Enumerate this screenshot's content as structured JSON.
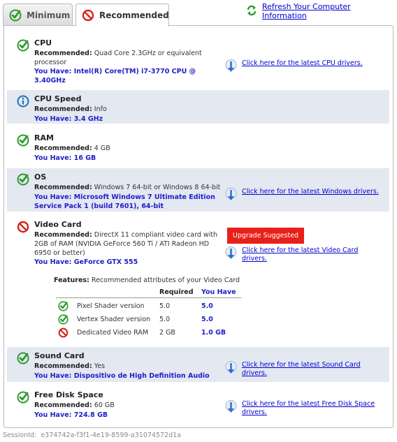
{
  "tabs": {
    "minimum_label": "Minimum",
    "recommended_label": "Recommended"
  },
  "refresh_label": "Refresh Your Computer Information",
  "sections": {
    "cpu": {
      "title": "CPU",
      "recommended_label": "Recommended:",
      "recommended_value": "Quad Core 2.3GHz or equivalent processor",
      "have_label": "You Have:",
      "have_value": "Intel(R) Core(TM) i7-3770 CPU @ 3.40GHz",
      "driver_link": "Click here for the latest CPU drivers.",
      "status_icon": "check-icon"
    },
    "cpu_speed": {
      "title": "CPU Speed",
      "recommended_label": "Recommended:",
      "recommended_value": "Info",
      "have_label": "You Have:",
      "have_value": "3.4 GHz",
      "status_icon": "info-icon"
    },
    "ram": {
      "title": "RAM",
      "recommended_label": "Recommended:",
      "recommended_value": "4 GB",
      "have_label": "You Have:",
      "have_value": "16 GB",
      "status_icon": "check-icon"
    },
    "os": {
      "title": "OS",
      "recommended_label": "Recommended:",
      "recommended_value": "Windows 7 64-bit or Windows 8 64-bit",
      "have_label": "You Have:",
      "have_value": "Microsoft Windows 7 Ultimate Edition Service Pack 1 (build 7601), 64-bit",
      "driver_link": "Click here for the latest Windows drivers.",
      "status_icon": "check-icon"
    },
    "video": {
      "title": "Video Card",
      "recommended_label": "Recommended:",
      "recommended_value": "DirectX 11 compliant video card with 2GB of RAM (NVIDIA GeForce 560 Ti / ATI Radeon HD 6950 or better)",
      "have_label": "You Have:",
      "have_value": "GeForce GTX 555",
      "upgrade_label": "Upgrade Suggested",
      "driver_link": "Click here for the latest Video Card drivers.",
      "status_icon": "no-icon",
      "features_label": "Features:",
      "features_text": "Recommended attributes of your Video Card",
      "col_required": "Required",
      "col_have": "You Have",
      "features": [
        {
          "name": "Pixel Shader version",
          "required": "5.0",
          "have": "5.0",
          "status_icon": "check-icon"
        },
        {
          "name": "Vertex Shader version",
          "required": "5.0",
          "have": "5.0",
          "status_icon": "check-icon"
        },
        {
          "name": "Dedicated Video RAM",
          "required": "2 GB",
          "have": "1.0 GB",
          "status_icon": "no-icon"
        }
      ]
    },
    "sound": {
      "title": "Sound Card",
      "recommended_label": "Recommended:",
      "recommended_value": "Yes",
      "have_label": "You Have:",
      "have_value": "Dispositivo de High Definition Audio",
      "driver_link": "Click here for the latest Sound Card drivers.",
      "status_icon": "check-icon"
    },
    "disk": {
      "title": "Free Disk Space",
      "recommended_label": "Recommended:",
      "recommended_value": "60 GB",
      "have_label": "You Have:",
      "have_value": "724.8 GB",
      "driver_link": "Click here for the latest Free Disk Space drivers.",
      "status_icon": "check-icon"
    }
  },
  "session_label": "SessionId:",
  "session_id": "e374742a-f3f1-4e19-8599-a31074572d1a",
  "colors": {
    "check": "#2e9a2e",
    "no": "#d8201a",
    "info": "#1e73be",
    "link": "#0000cc",
    "have": "#1e1ec8",
    "shade": "#e4e8f1",
    "upgrade": "#e8201a"
  }
}
